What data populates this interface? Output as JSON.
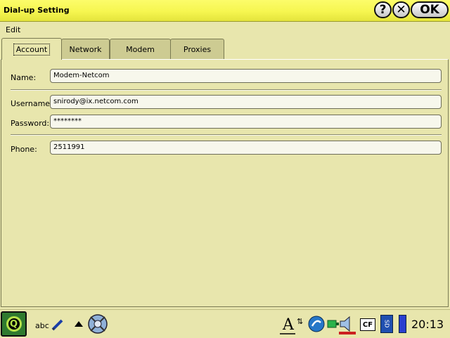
{
  "window": {
    "title": "Dial-up Setting",
    "help_label": "?",
    "close_label": "✕",
    "ok_label": "OK"
  },
  "menu": {
    "edit": "Edit"
  },
  "tabs": [
    {
      "label": "Account",
      "active": true
    },
    {
      "label": "Network"
    },
    {
      "label": "Modem"
    },
    {
      "label": "Proxies"
    }
  ],
  "account": {
    "name_label": "Name:",
    "name_value": "Modem-Netcom",
    "username_label": "Username:",
    "username_value": "snirody@ix.netcom.com",
    "password_label": "Password:",
    "password_value": "********",
    "phone_label": "Phone:",
    "phone_value": "2511991"
  },
  "taskbar": {
    "input_method": "abc",
    "storage_card": "CF",
    "sd_card": "SD",
    "clock": "20:13"
  },
  "colors": {
    "titlebar": "#f6f650",
    "background": "#e8e6ad",
    "start_button": "#2f7a2f"
  }
}
